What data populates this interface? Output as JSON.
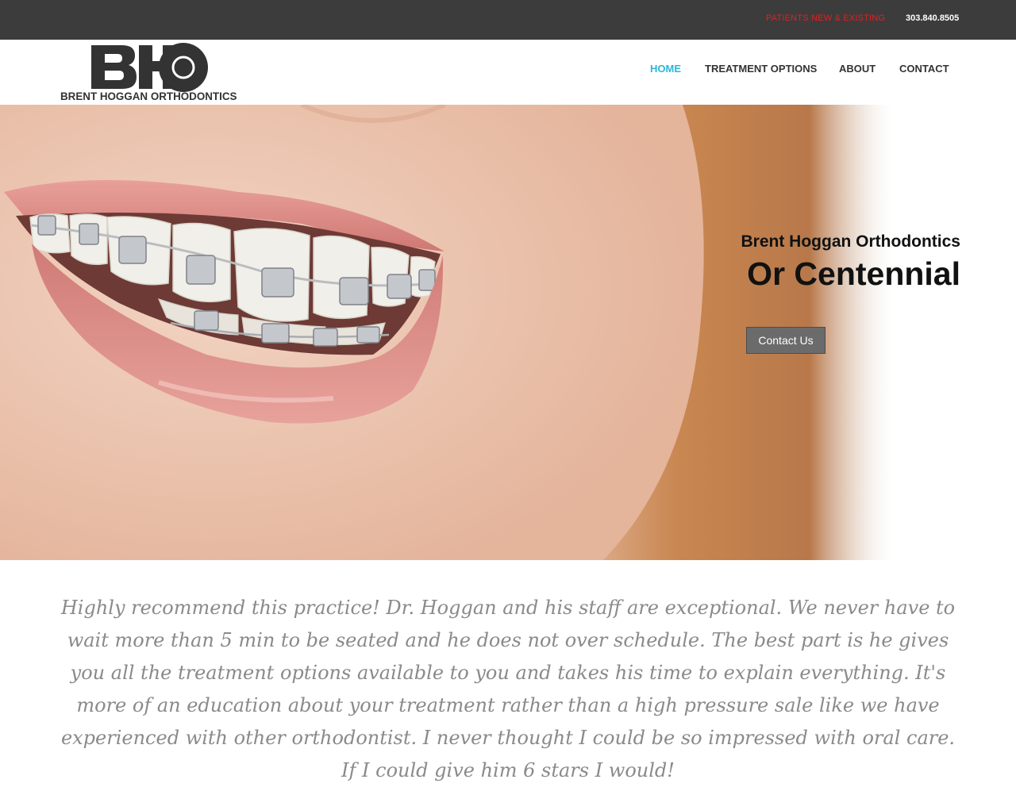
{
  "topbar": {
    "patients_link": "PATIENTS NEW & EXISTING",
    "phone": "303.840.8505"
  },
  "logo": {
    "monogram": "BHO",
    "name": "BRENT HOGGAN ORTHODONTICS"
  },
  "nav": {
    "items": [
      {
        "label": "HOME",
        "active": true
      },
      {
        "label": "TREATMENT OPTIONS",
        "active": false
      },
      {
        "label": "ABOUT",
        "active": false
      },
      {
        "label": "CONTACT",
        "active": false
      }
    ]
  },
  "hero": {
    "subtitle": "Brent Hoggan Orthodontics",
    "title": "Or Centennial",
    "cta_label": "Contact Us"
  },
  "testimonial": {
    "text": "Highly recommend this practice! Dr. Hoggan and his staff are exceptional. We never have to wait more than 5 min to be seated and he does not over schedule. The best part is he gives you all the treatment options available to you and takes his time to explain everything. It's more of an education about your treatment rather than a high pressure sale like we have experienced with other orthodontist. I never thought I could be so impressed with oral care. If I could give him 6 stars I would!"
  },
  "colors": {
    "topbar_bg": "#3c3c3c",
    "patients_link": "#e02020",
    "nav_active": "#2bb8d6",
    "cta_bg": "#6b6b6b",
    "testimonial_text": "#8a8a8a"
  }
}
